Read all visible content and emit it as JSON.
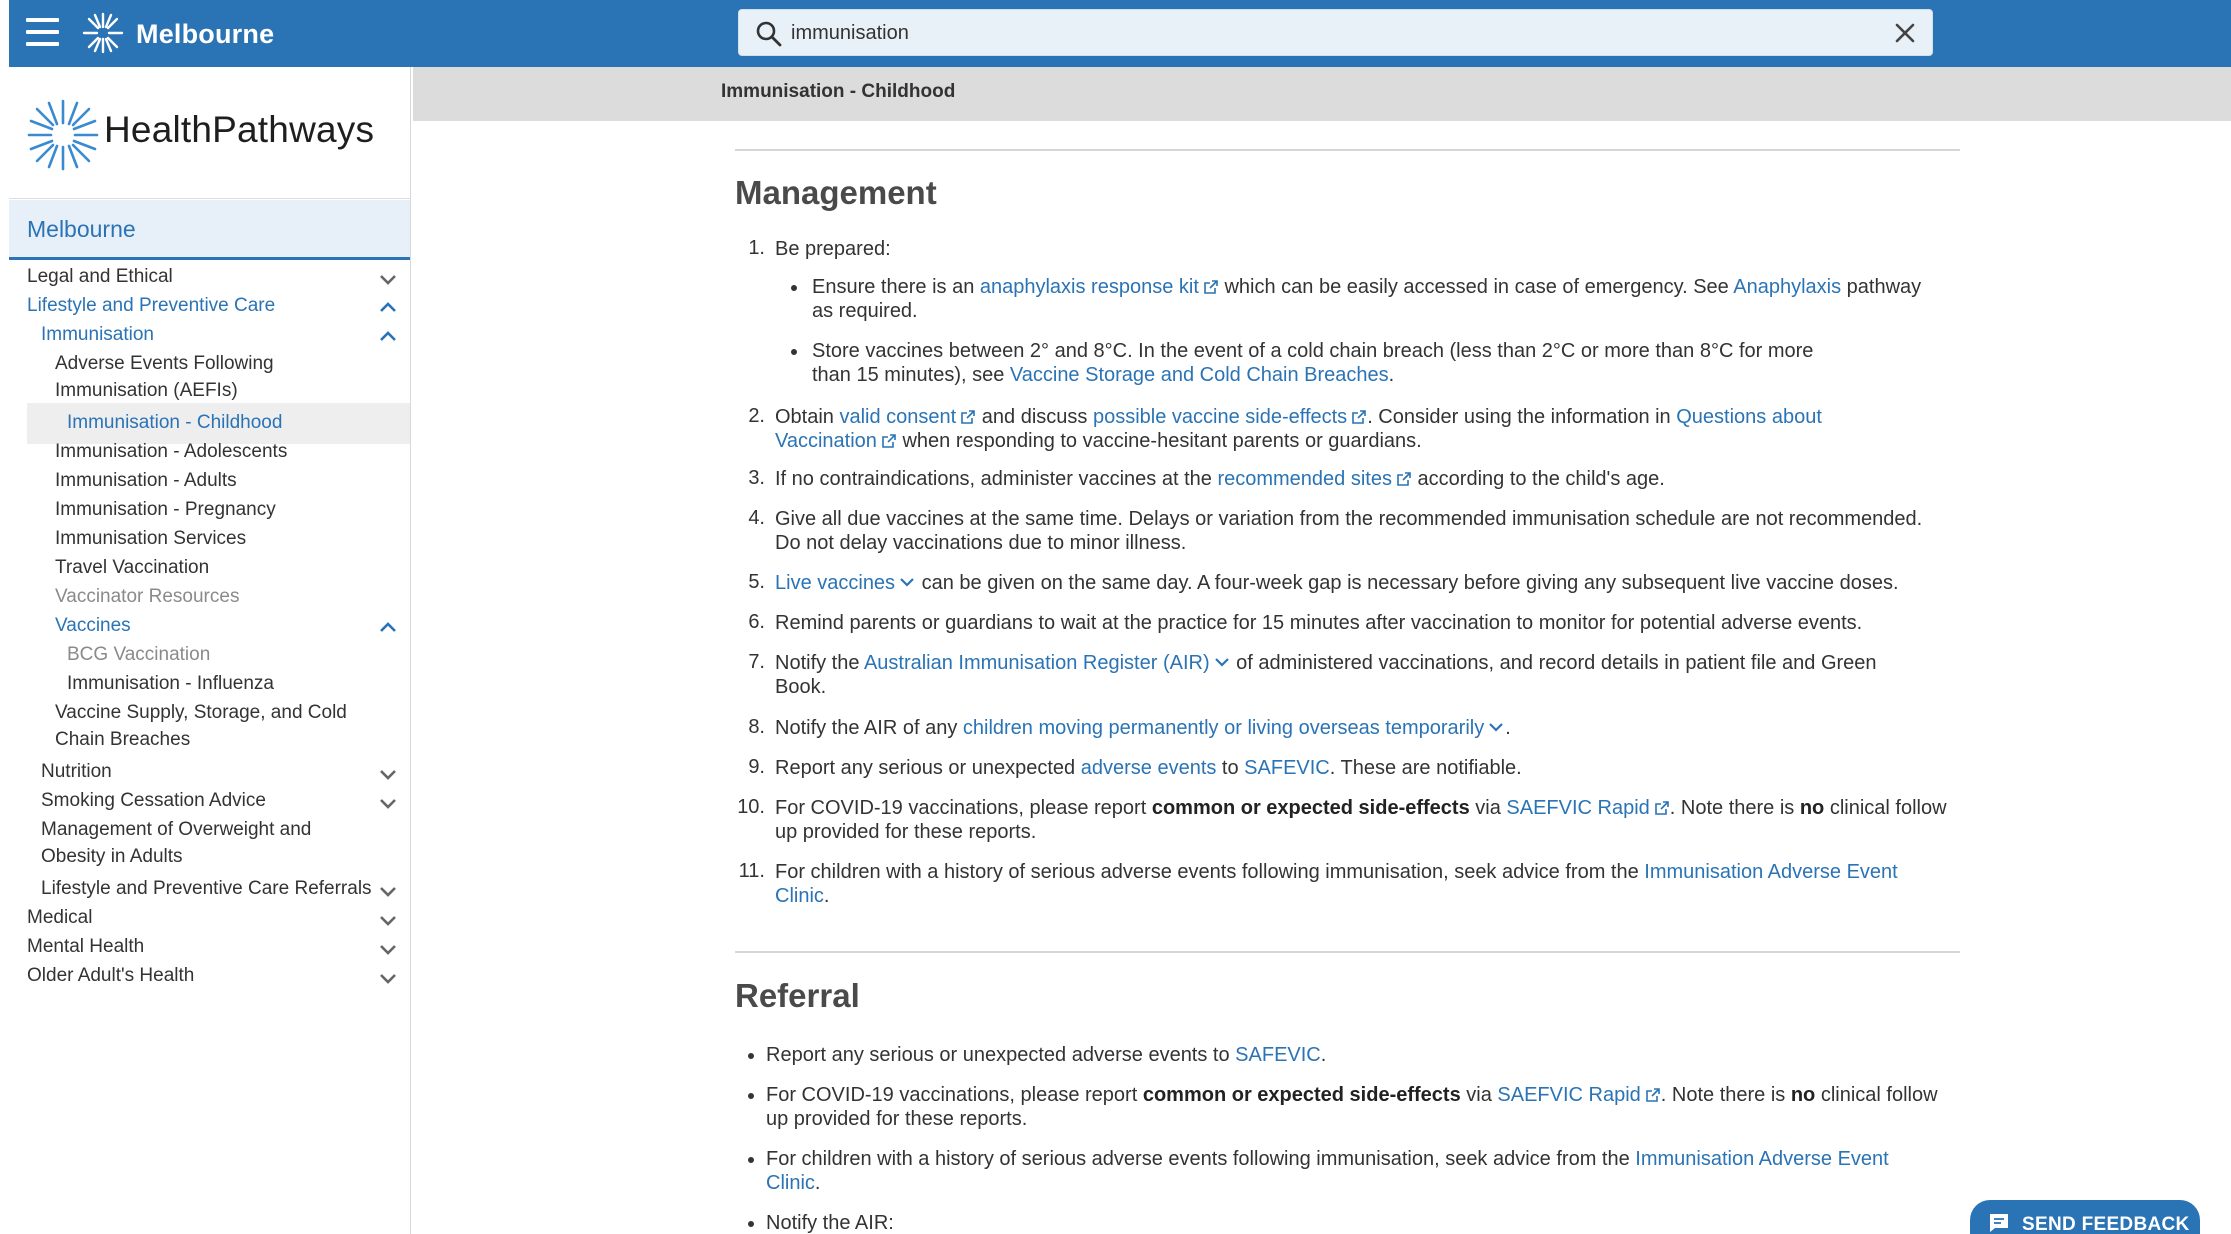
{
  "topbar": {
    "region_title": "Melbourne",
    "search_value": "immunisation",
    "icons": {
      "menu": "hamburger-menu-icon",
      "logo": "healthpathways-star-icon",
      "search": "magnifier-icon",
      "clear": "close-icon"
    }
  },
  "sidebar": {
    "brand": "HealthPathways",
    "region": "Melbourne",
    "items": [
      {
        "label": "Legal and Ethical",
        "indent": 0,
        "color": "dark",
        "chevron": "down"
      },
      {
        "label": "Lifestyle and Preventive Care",
        "indent": 0,
        "color": "blue",
        "chevron": "up"
      },
      {
        "label": "Immunisation",
        "indent": 1,
        "color": "blue",
        "chevron": "up"
      },
      {
        "label": "Adverse Events Following",
        "label2": "Immunisation (AEFIs)",
        "indent": 2,
        "color": "dark",
        "chevron": ""
      },
      {
        "label": "Immunisation - Childhood",
        "indent": 3,
        "color": "blue",
        "chevron": "",
        "active": true
      },
      {
        "label": "Immunisation - Adolescents",
        "indent": 2,
        "color": "dark",
        "chevron": ""
      },
      {
        "label": "Immunisation - Adults",
        "indent": 2,
        "color": "dark",
        "chevron": ""
      },
      {
        "label": "Immunisation - Pregnancy",
        "indent": 2,
        "color": "dark",
        "chevron": ""
      },
      {
        "label": "Immunisation Services",
        "indent": 2,
        "color": "dark",
        "chevron": ""
      },
      {
        "label": "Travel Vaccination",
        "indent": 2,
        "color": "dark",
        "chevron": ""
      },
      {
        "label": "Vaccinator Resources",
        "indent": 2,
        "color": "grey",
        "chevron": ""
      },
      {
        "label": "Vaccines",
        "indent": 2,
        "color": "blue",
        "chevron": "up"
      },
      {
        "label": "BCG Vaccination",
        "indent": 3,
        "color": "grey",
        "chevron": ""
      },
      {
        "label": "Immunisation - Influenza",
        "indent": 3,
        "color": "dark",
        "chevron": ""
      },
      {
        "label": "Vaccine Supply, Storage, and Cold",
        "label2": "Chain Breaches",
        "indent": 2,
        "color": "dark",
        "chevron": ""
      },
      {
        "label": "Nutrition",
        "indent": 1,
        "color": "dark",
        "chevron": "down"
      },
      {
        "label": "Smoking Cessation Advice",
        "indent": 1,
        "color": "dark",
        "chevron": "down"
      },
      {
        "label": "Management of Overweight and",
        "label2": "Obesity in Adults",
        "indent": 1,
        "color": "dark",
        "chevron": ""
      },
      {
        "label": "Lifestyle and Preventive Care Referrals",
        "indent": 1,
        "color": "dark",
        "chevron": "down"
      },
      {
        "label": "Medical",
        "indent": 0,
        "color": "dark",
        "chevron": "down"
      },
      {
        "label": "Mental Health",
        "indent": 0,
        "color": "dark",
        "chevron": "down"
      },
      {
        "label": "Older Adult's Health",
        "indent": 0,
        "color": "dark",
        "chevron": "down"
      }
    ]
  },
  "breadcrumb": "Immunisation - Childhood",
  "management": {
    "heading": "Management",
    "item1": "Be prepared:",
    "item1_b1_pre": "Ensure there is an ",
    "item1_b1_link1": "anaphylaxis response kit",
    "item1_b1_mid": " which can be easily accessed in case of emergency. See ",
    "item1_b1_link2": "Anaphylaxis",
    "item1_b1_post": " pathway",
    "item1_b1_line2": "as required.",
    "item1_b2_line1": "Store vaccines between 2° and 8°C. In the event of a cold chain breach (less than 2°C or more than 8°C for more",
    "item1_b2_pre": "than 15 minutes), see ",
    "item1_b2_link": "Vaccine Storage and Cold Chain Breaches",
    "item1_b2_post": ".",
    "item2_pre": "Obtain ",
    "item2_link1": "valid consent",
    "item2_mid1": " and discuss ",
    "item2_link2": "possible vaccine side-effects",
    "item2_mid2": ". Consider using the information in ",
    "item2_link3a": "Questions about",
    "item2_link3b": "Vaccination",
    "item2_post": " when responding to vaccine-hesitant parents or guardians.",
    "item3_pre": "If no contraindications, administer vaccines at the ",
    "item3_link": "recommended sites",
    "item3_post": " according to the child's age.",
    "item4_line1": "Give all due vaccines at the same time. Delays or variation from the recommended immunisation schedule are not recommended.",
    "item4_line2": "Do not delay vaccinations due to minor illness.",
    "item5_link": "Live vaccines",
    "item5_post": " can be given on the same day. A four-week gap is necessary before giving any subsequent live vaccine doses.",
    "item6": "Remind parents or guardians to wait at the practice for 15 minutes after vaccination to monitor for potential adverse events.",
    "item7_pre": "Notify the ",
    "item7_link": "Australian Immunisation Register (AIR)",
    "item7_post": " of administered vaccinations, and record details in patient file and Green",
    "item7_line2": "Book.",
    "item8_pre": "Notify the AIR of any ",
    "item8_link": "children moving permanently or living overseas temporarily",
    "item8_post": ".",
    "item9_pre": "Report any serious or unexpected ",
    "item9_link1": "adverse events",
    "item9_mid": " to ",
    "item9_link2": "SAFEVIC",
    "item9_post": ". These are notifiable.",
    "item10_pre": "For COVID-19 vaccinations, please report ",
    "item10_bold": "common or expected side-effects",
    "item10_mid": " via ",
    "item10_link": "SAEFVIC Rapid",
    "item10_post1": ". Note there is ",
    "item10_bold2": "no",
    "item10_post2": " clinical follow",
    "item10_line2": "up provided for these reports.",
    "item11_pre": "For children with a history of serious adverse events following immunisation, seek advice from the ",
    "item11_link_a": "Immunisation Adverse Event",
    "item11_link_b": "Clinic",
    "item11_post": "."
  },
  "referral": {
    "heading": "Referral",
    "b1_pre": "Report any serious or unexpected adverse events to ",
    "b1_link": "SAFEVIC",
    "b1_post": ".",
    "b2_pre": "For COVID-19 vaccinations, please report ",
    "b2_bold": "common or expected side-effects",
    "b2_mid": " via ",
    "b2_link": "SAEFVIC Rapid",
    "b2_post1": ". Note there is ",
    "b2_bold2": "no",
    "b2_post2": " clinical follow",
    "b2_line2": "up provided for these reports.",
    "b3_pre": "For children with a history of serious adverse events following immunisation, seek advice from the ",
    "b3_link_a": "Immunisation Adverse Event",
    "b3_link_b": "Clinic",
    "b3_post": ".",
    "b4": "Notify the AIR:"
  },
  "numbers": [
    "1.",
    "2.",
    "3.",
    "4.",
    "5.",
    "6.",
    "7.",
    "8.",
    "9.",
    "10.",
    "11."
  ],
  "feedback": {
    "label": "SEND FEEDBACK"
  },
  "colors": {
    "brand_blue": "#2a73b5",
    "link": "#2a73b5",
    "crumb_bg": "#dcdcdc"
  }
}
